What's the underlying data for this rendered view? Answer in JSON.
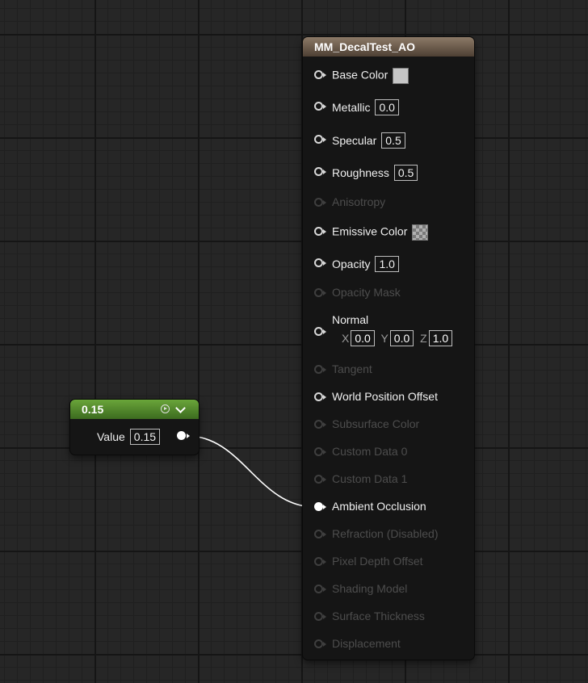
{
  "main_node": {
    "title": "MM_DecalTest_AO",
    "pins": [
      {
        "label": "Base Color",
        "kind": "swatch-gray",
        "enabled": true
      },
      {
        "label": "Metallic",
        "value": "0.0",
        "enabled": true
      },
      {
        "label": "Specular",
        "value": "0.5",
        "enabled": true
      },
      {
        "label": "Roughness",
        "value": "0.5",
        "enabled": true
      },
      {
        "label": "Anisotropy",
        "enabled": false
      },
      {
        "label": "Emissive Color",
        "kind": "swatch-checker",
        "enabled": true
      },
      {
        "label": "Opacity",
        "value": "1.0",
        "enabled": true
      },
      {
        "label": "Opacity Mask",
        "enabled": false
      },
      {
        "label": "Normal",
        "enabled": true,
        "x": "0.0",
        "y": "0.0",
        "z": "1.0",
        "x_label": "X",
        "y_label": "Y",
        "z_label": "Z"
      },
      {
        "label": "Tangent",
        "enabled": false
      },
      {
        "label": "World Position Offset",
        "enabled": true
      },
      {
        "label": "Subsurface Color",
        "enabled": false
      },
      {
        "label": "Custom Data 0",
        "enabled": false
      },
      {
        "label": "Custom Data 1",
        "enabled": false
      },
      {
        "label": "Ambient Occlusion",
        "enabled": true,
        "connected": true
      },
      {
        "label": "Refraction (Disabled)",
        "enabled": false
      },
      {
        "label": "Pixel Depth Offset",
        "enabled": false
      },
      {
        "label": "Shading Model",
        "enabled": false
      },
      {
        "label": "Surface Thickness",
        "enabled": false
      },
      {
        "label": "Displacement",
        "enabled": false
      }
    ]
  },
  "constant_node": {
    "title": "0.15",
    "value_label": "Value",
    "value": "0.15"
  },
  "colors": {
    "main_header": "#6b5a4a",
    "constant_header": "#4f8a2a",
    "wire": "#ffffff"
  }
}
